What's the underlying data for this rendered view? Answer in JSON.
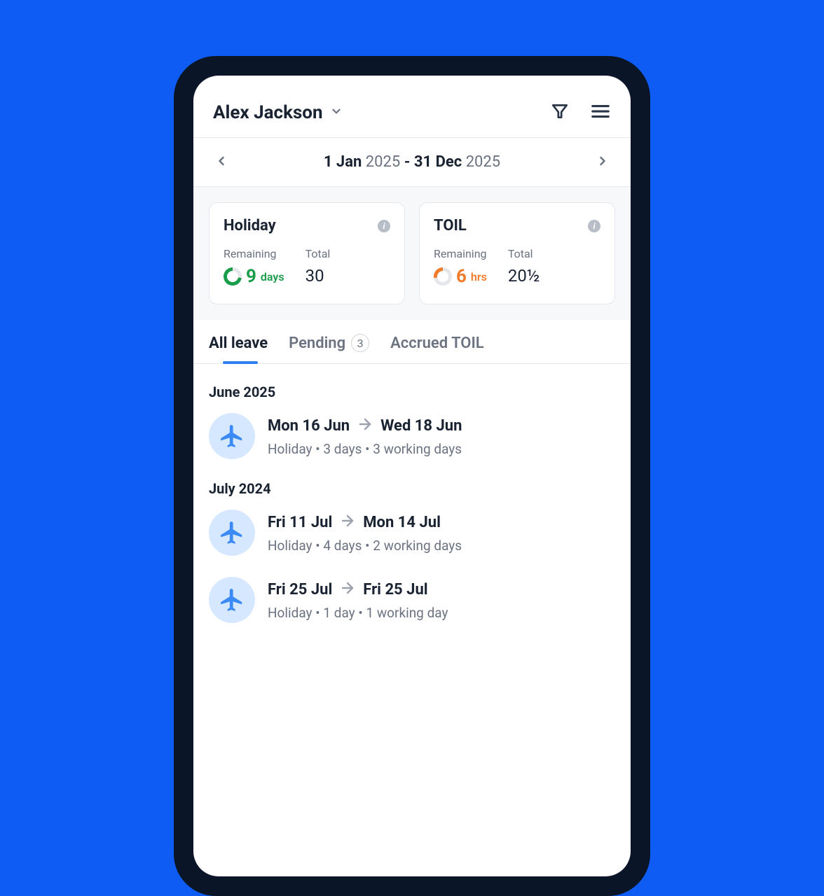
{
  "header": {
    "user_name": "Alex Jackson"
  },
  "date_nav": {
    "start_day": "1 Jan",
    "start_year": "2025",
    "end_day": "31 Dec",
    "end_year": "2025"
  },
  "cards": {
    "holiday": {
      "title": "Holiday",
      "remaining_label": "Remaining",
      "remaining_value": "9",
      "remaining_unit": "days",
      "total_label": "Total",
      "total_value": "30"
    },
    "toil": {
      "title": "TOIL",
      "remaining_label": "Remaining",
      "remaining_value": "6",
      "remaining_unit": "hrs",
      "total_label": "Total",
      "total_value": "20½"
    }
  },
  "tabs": {
    "all_leave": "All leave",
    "pending": "Pending",
    "pending_count": "3",
    "accrued_toil": "Accrued TOIL"
  },
  "sections": [
    {
      "month": "June 2025",
      "items": [
        {
          "date_from": "Mon 16 Jun",
          "date_to": "Wed 18 Jun",
          "meta": "Holiday  •  3 days  •  3 working days"
        }
      ]
    },
    {
      "month": "July 2024",
      "items": [
        {
          "date_from": "Fri 11 Jul",
          "date_to": "Mon 14 Jul",
          "meta": "Holiday  •  4 days  •  2 working days"
        },
        {
          "date_from": "Fri 25 Jul",
          "date_to": "Fri 25 Jul",
          "meta": "Holiday  •  1 day  •  1 working day"
        }
      ]
    }
  ]
}
